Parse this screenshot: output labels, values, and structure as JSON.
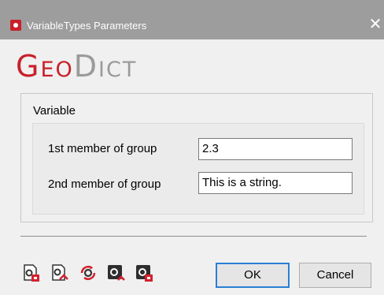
{
  "window": {
    "title": "VariableTypes Parameters",
    "close_glyph": "✕"
  },
  "logo": {
    "geo_cap": "G",
    "geo_rest": "EO",
    "dict_cap": "D",
    "dict_rest": "ICT",
    "colors": {
      "geo": "#c8202b",
      "dict": "#9a9a9a"
    }
  },
  "group": {
    "title": "Variable",
    "fields": [
      {
        "label": "1st member of group",
        "value": "2.3"
      },
      {
        "label": "2nd member of group",
        "value": "This is a string."
      }
    ]
  },
  "toolbar": {
    "icons": [
      "load-settings-icon",
      "save-settings-icon",
      "reset-settings-icon",
      "load-macro-icon",
      "save-macro-icon"
    ]
  },
  "buttons": {
    "ok": "OK",
    "cancel": "Cancel"
  }
}
